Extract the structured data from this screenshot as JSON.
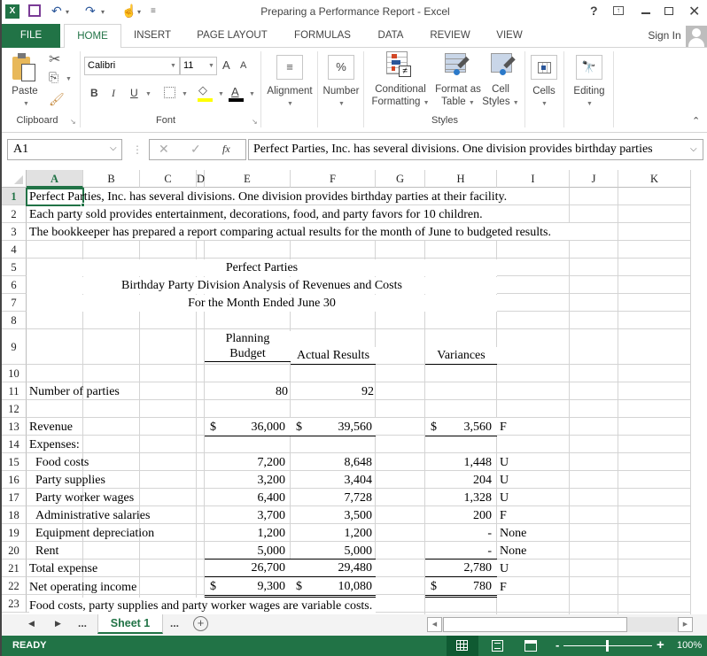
{
  "window": {
    "title": "Preparing a Performance Report - Excel",
    "help": "?",
    "controls": [
      "ribbon-display",
      "minimize",
      "restore",
      "close"
    ]
  },
  "tabs": {
    "file": "FILE",
    "items": [
      "HOME",
      "INSERT",
      "PAGE LAYOUT",
      "FORMULAS",
      "DATA",
      "REVIEW",
      "VIEW"
    ],
    "active": "HOME",
    "sign_in": "Sign In"
  },
  "ribbon": {
    "clipboard": {
      "paste": "Paste",
      "group": "Clipboard"
    },
    "font": {
      "name": "Calibri",
      "size": "11",
      "bold": "B",
      "italic": "I",
      "underline": "U",
      "grow": "A",
      "shrink": "A",
      "font_color": "A",
      "group": "Font",
      "fill_color": "#ffff00",
      "text_color": "#000000"
    },
    "alignment": "Alignment",
    "number": "Number",
    "number_icon": "%",
    "conditional_formatting": [
      "Conditional",
      "Formatting"
    ],
    "format_as_table": [
      "Format as",
      "Table"
    ],
    "cell_styles": [
      "Cell",
      "Styles"
    ],
    "styles_group": "Styles",
    "cells": "Cells",
    "editing": "Editing"
  },
  "formula_bar": {
    "name_box": "A1",
    "fx": "fx",
    "formula": "Perfect Parties, Inc. has several divisions.  One division provides birthday parties"
  },
  "columns": [
    "A",
    "B",
    "C",
    "D",
    "E",
    "F",
    "G",
    "H",
    "I",
    "J",
    "K"
  ],
  "selected_cell": "A1",
  "rows": [
    "1",
    "2",
    "3",
    "4",
    "5",
    "6",
    "7",
    "8",
    "9",
    "10",
    "11",
    "12",
    "13",
    "14",
    "15",
    "16",
    "17",
    "18",
    "19",
    "20",
    "21",
    "22",
    "23"
  ],
  "sheet": {
    "r1": "Perfect Parties, Inc. has several divisions.  One division provides birthday parties at their facility.",
    "r2": "Each party sold provides entertainment, decorations, food, and party favors for 10 children.",
    "r3": "The bookkeeper has prepared a report comparing actual results for the month of June to budgeted results.",
    "r5": "Perfect Parties",
    "r6": "Birthday Party Division Analysis of Revenues and Costs",
    "r7": "For the Month Ended June 30",
    "hdr_budget_1": "Planning",
    "hdr_budget_2": "Budget",
    "hdr_actual": "Actual Results",
    "hdr_var": "Variances",
    "r11": {
      "label": "Number of parties",
      "budget": "80",
      "actual": "92"
    },
    "r13": {
      "label": "Revenue",
      "cur": "$",
      "budget": "36,000",
      "actual": "39,560",
      "var": "3,560",
      "fu": "F"
    },
    "r14": {
      "label": "Expenses:"
    },
    "expenses": [
      {
        "label": "Food costs",
        "budget": "7,200",
        "actual": "8,648",
        "var": "1,448",
        "fu": "U"
      },
      {
        "label": "Party supplies",
        "budget": "3,200",
        "actual": "3,404",
        "var": "204",
        "fu": "U"
      },
      {
        "label": "Party worker wages",
        "budget": "6,400",
        "actual": "7,728",
        "var": "1,328",
        "fu": "U"
      },
      {
        "label": "Administrative salaries",
        "budget": "3,700",
        "actual": "3,500",
        "var": "200",
        "fu": "F"
      },
      {
        "label": "Equipment depreciation",
        "budget": "1,200",
        "actual": "1,200",
        "var": "-",
        "fu": "None"
      },
      {
        "label": "Rent",
        "budget": "5,000",
        "actual": "5,000",
        "var": "-",
        "fu": "None"
      }
    ],
    "r21": {
      "label": "Total expense",
      "budget": "26,700",
      "actual": "29,480",
      "var": "2,780",
      "fu": "U"
    },
    "r22": {
      "label": "Net operating income",
      "cur": "$",
      "budget": "9,300",
      "actual": "10,080",
      "var": "780",
      "fu": "F"
    },
    "r23": "Food costs, party supplies and party worker wages are variable costs."
  },
  "sheet_tabs": {
    "ellipsis": "...",
    "active": "Sheet 1",
    "add": "+"
  },
  "status": {
    "mode": "READY",
    "zoom": "100%",
    "zoom_minus": "-",
    "zoom_plus": "+"
  }
}
